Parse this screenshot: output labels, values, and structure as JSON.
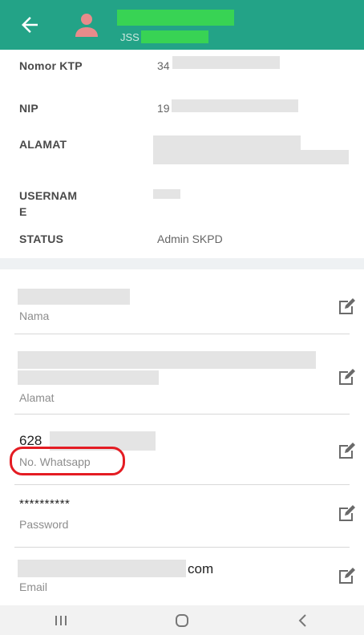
{
  "header": {
    "subtitle_prefix": "JSS",
    "colors": {
      "bar": "#23a387",
      "redaction": "#38d354"
    },
    "icons": [
      "back-arrow-icon",
      "user-avatar-icon"
    ]
  },
  "profile_info": [
    {
      "label": "Nomor KTP",
      "value": "34"
    },
    {
      "label": "NIP",
      "value": "19"
    },
    {
      "label": "ALAMAT",
      "value": ""
    },
    {
      "label": "USERNAM\nE",
      "value": ""
    },
    {
      "label": "STATUS",
      "value": "Admin SKPD"
    }
  ],
  "editable_fields": [
    {
      "label": "Nama",
      "value": ""
    },
    {
      "label": "Alamat",
      "value": ""
    },
    {
      "label": "No. Whatsapp",
      "value": "628"
    },
    {
      "label": "Password",
      "value": "**********"
    },
    {
      "label": "Email",
      "value": "com"
    }
  ],
  "edit_icon": "edit-pencil-icon",
  "highlight_color": "#e41c23",
  "system_nav": [
    "recent-apps-icon",
    "home-icon",
    "back-icon"
  ]
}
